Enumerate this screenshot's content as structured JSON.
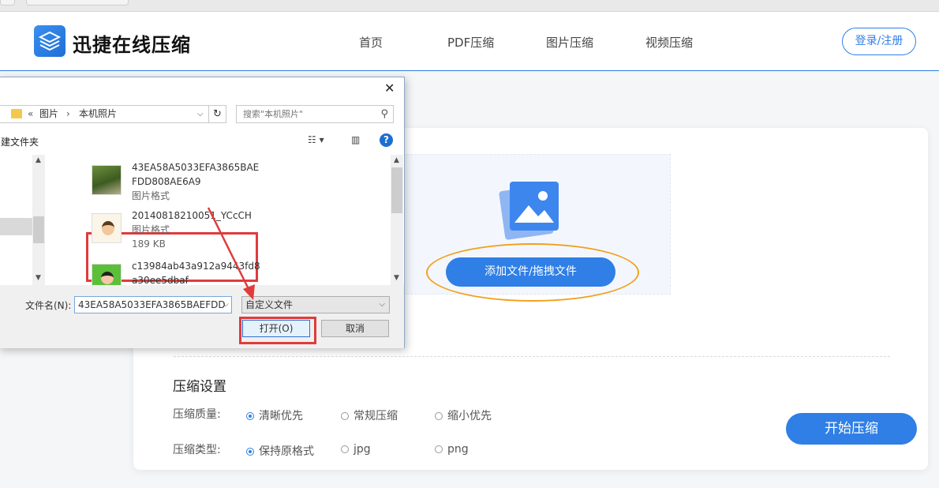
{
  "site": {
    "brand": "迅捷在线压缩",
    "nav": [
      "首页",
      "PDF压缩",
      "图片压缩",
      "视频压缩"
    ],
    "login": "登录/注册"
  },
  "upload": {
    "add_button": "添加文件/拖拽文件"
  },
  "settings": {
    "title": "压缩设置",
    "quality_label": "压缩质量:",
    "quality_options": [
      "清晰优先",
      "常规压缩",
      "缩小优先"
    ],
    "quality_selected": "清晰优先",
    "type_label": "压缩类型:",
    "type_options": [
      "保持原格式",
      "jpg",
      "png"
    ],
    "type_selected": "保持原格式",
    "start_button": "开始压缩"
  },
  "dialog": {
    "breadcrumb_prefix": "«",
    "breadcrumb": [
      "图片",
      "本机照片"
    ],
    "search_placeholder": "搜索\"本机照片\"",
    "new_folder": "建文件夹",
    "files": [
      {
        "name_line1": "43EA58A5033EFA3865BAE",
        "name_line2": "FDD808AE6A9",
        "type": "图片格式",
        "size": ""
      },
      {
        "name_line1": "20140818210051_YCcCH",
        "name_line2": "",
        "type": "图片格式",
        "size": "189 KB"
      },
      {
        "name_line1": "c13984ab43a912a9443fd8",
        "name_line2": "a30ee5dbaf",
        "type": "",
        "size": ""
      }
    ],
    "filename_label": "文件名(N):",
    "filename_value": "43EA58A5033EFA3865BAEFDD",
    "filetype_value": "自定义文件",
    "open_button": "打开(O)",
    "cancel_button": "取消"
  },
  "colors": {
    "accent": "#2f7fe6",
    "highlight_red": "#e03b3b",
    "ellipse_orange": "#f1a11e"
  }
}
